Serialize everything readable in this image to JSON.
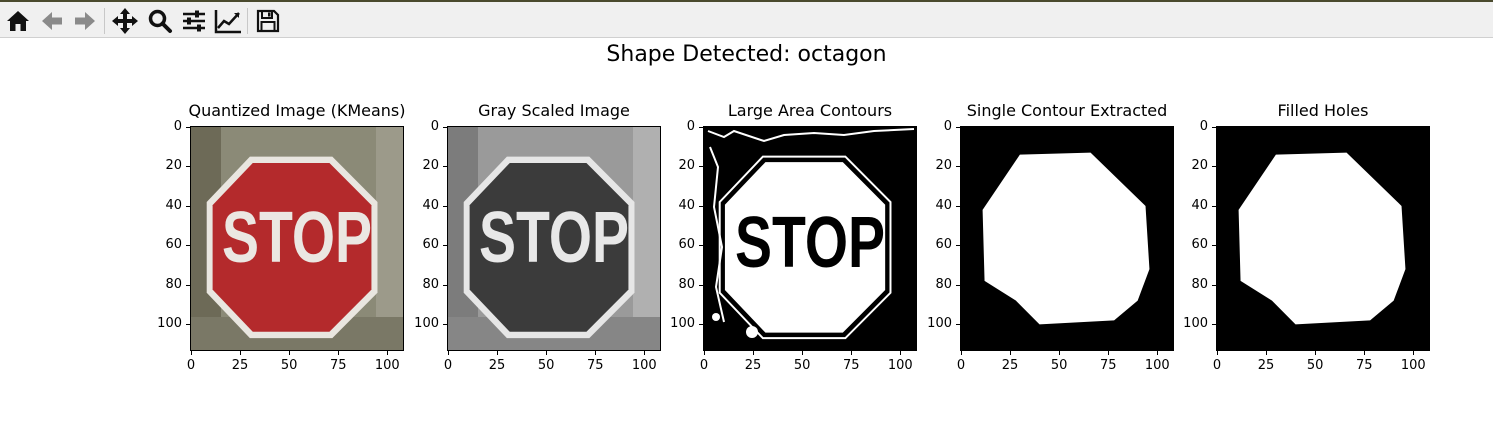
{
  "toolbar": {
    "buttons": [
      {
        "id": "home",
        "icon": "home-icon"
      },
      {
        "id": "back",
        "icon": "arrow-left-icon"
      },
      {
        "id": "forward",
        "icon": "arrow-right-icon"
      },
      {
        "id": "pan",
        "icon": "move-icon"
      },
      {
        "id": "zoom",
        "icon": "magnifier-icon"
      },
      {
        "id": "configure",
        "icon": "sliders-icon"
      },
      {
        "id": "edit-axis",
        "icon": "line-chart-icon"
      },
      {
        "id": "save",
        "icon": "floppy-disk-icon"
      }
    ]
  },
  "figure": {
    "suptitle": "Shape Detected: octagon",
    "panels": [
      {
        "title": "Quantized Image (KMeans)"
      },
      {
        "title": "Gray Scaled Image"
      },
      {
        "title": "Large Area Contours"
      },
      {
        "title": "Single Contour Extracted"
      },
      {
        "title": "Filled Holes"
      }
    ],
    "yticks": [
      "0",
      "20",
      "40",
      "60",
      "80",
      "100"
    ],
    "xticks": [
      "0",
      "25",
      "50",
      "75",
      "100"
    ],
    "sign_text": "STOP",
    "colors": {
      "stop_red": "#b42a2c",
      "gray_sign": "#3a3a3a",
      "background": "#ffffff",
      "toolbar": "#f0f0f0"
    }
  }
}
